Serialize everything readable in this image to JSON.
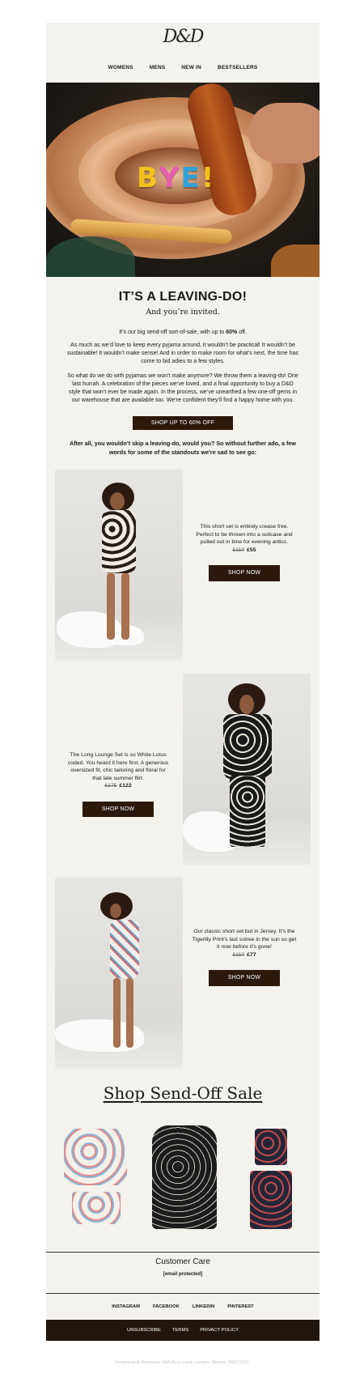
{
  "brand": {
    "logo_text": "D&D"
  },
  "nav": {
    "items": [
      "WOMENS",
      "MENS",
      "NEW IN",
      "BESTSELLERS"
    ]
  },
  "hero": {
    "word": [
      "B",
      "Y",
      "E",
      "!"
    ],
    "letter_colors": [
      "#f2c21a",
      "#e75fae",
      "#2fa3d8",
      "#f2c21a"
    ]
  },
  "intro": {
    "title": "IT’S A LEAVING-DO!",
    "subtitle": "And you’re invited.",
    "lead_prefix": "It’s our big send-off sort-of-sale, with up to ",
    "lead_bold": "60%",
    "lead_suffix": " off.",
    "para1": "As much as we’d love to keep every pyjama around, it wouldn’t be practical! It wouldn’t be sustainable! It wouldn’t make sense! And in order to make room for what’s next, the time has come to bid adieu to a few styles.",
    "para2": "So what do we do with pyjamas we won’t make anymore? We throw them a leaving-do! One last hurrah. A celebration of the pieces we’ve loved, and a final opportunity to buy a D&D style that won’t ever be made again. In the process, we’ve unearthed a few one-off gems in our warehouse that are available too. We’re confident they’ll find a happy home with you.",
    "cta": "SHOP UP TO 60% OFF",
    "para3": "After all, you wouldn’t skip a leaving-do, would you? So without further ado, a few words for some of the standouts we’re sad to see go:"
  },
  "products": [
    {
      "text": "This short set is entirely crease free. Perfect to be thrown into a suitcase and pulled out in time for evening antics.",
      "old_price": "£110",
      "new_price": "£55",
      "cta": "SHOP NOW"
    },
    {
      "text": "The Long Lounge Set is so White Lotus coded. You heard it here first. A generous oversized fit, chic tailoring and floral for that late summer flirt.",
      "old_price": "£175",
      "new_price": "£122",
      "cta": "SHOP NOW"
    },
    {
      "text": "Our classic short set but in Jersey. It’s the Tigerlily Print’s last soiree in the sun so get it now before it’s gone!",
      "old_price": "£110",
      "new_price": "£77",
      "cta": "SHOP NOW"
    }
  ],
  "shop_section": {
    "title": "Shop Send-Off Sale"
  },
  "care": {
    "title": "Customer Care",
    "email": "[email protected]"
  },
  "social": {
    "items": [
      "INSTAGRAM",
      "FACEBOOK",
      "LINKEDIN",
      "PINTEREST"
    ]
  },
  "footer": {
    "links": [
      "UNSUBSCRIBE",
      "TERMS",
      "PRIVACY POLICY"
    ],
    "address": "Desmond & Dempsey 30A Acre Lane London, Brixton SW2 5SG"
  }
}
